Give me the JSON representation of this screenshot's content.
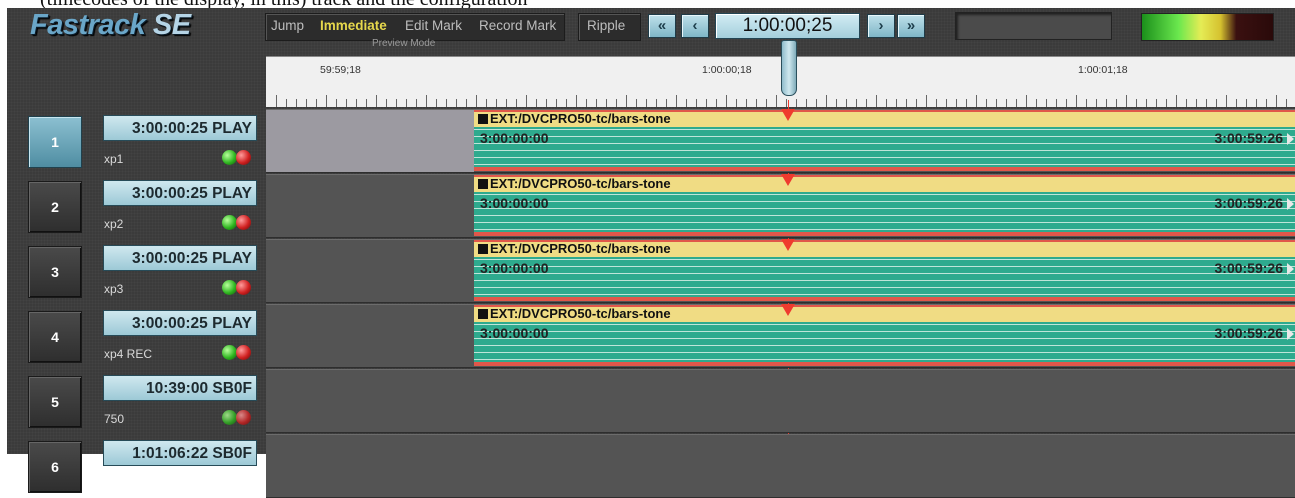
{
  "app": {
    "logo_main": "Fastrack",
    "logo_suffix": "SE"
  },
  "caption": {
    "text": "(timecodes of the display, in this) track and the configuration"
  },
  "toolbar": {
    "items": [
      "Jump",
      "Immediate",
      "Edit Mark",
      "Record Mark"
    ],
    "active": "Immediate",
    "ripple": "Ripple",
    "preview_mode_label": "Preview Mode"
  },
  "transport": {
    "rewind_all_icon": "double-left-arrow-icon",
    "step_back_icon": "left-arrow-icon",
    "timecode": "1:00:00;25",
    "step_forward_icon": "right-arrow-icon",
    "forward_all_icon": "double-right-arrow-icon"
  },
  "ruler": {
    "labels": [
      "59:59;18",
      "1:00:00;18",
      "1:00:01;18"
    ]
  },
  "tracks": [
    {
      "num": "1",
      "timecode": "3:00:00:25 PLAY",
      "name": "xp1",
      "selected": true,
      "clip": {
        "name": "EXT:/DVCPRO50-tc/bars-tone",
        "in": "3:00:00:00",
        "out": "3:00:59:26"
      }
    },
    {
      "num": "2",
      "timecode": "3:00:00:25 PLAY",
      "name": "xp2",
      "selected": false,
      "clip": {
        "name": "EXT:/DVCPRO50-tc/bars-tone",
        "in": "3:00:00:00",
        "out": "3:00:59:26"
      }
    },
    {
      "num": "3",
      "timecode": "3:00:00:25 PLAY",
      "name": "xp3",
      "selected": false,
      "clip": {
        "name": "EXT:/DVCPRO50-tc/bars-tone",
        "in": "3:00:00:00",
        "out": "3:00:59:26"
      }
    },
    {
      "num": "4",
      "timecode": "3:00:00:25 PLAY",
      "name": "xp4 REC",
      "selected": false,
      "clip": {
        "name": "EXT:/DVCPRO50-tc/bars-tone",
        "in": "3:00:00:00",
        "out": "3:00:59:26"
      }
    },
    {
      "num": "5",
      "timecode": "10:39:00 SB0F",
      "name": "750",
      "selected": false,
      "clip": null
    },
    {
      "num": "6",
      "timecode": "1:01:06:22 SB0F",
      "name": "",
      "selected": false,
      "clip": null
    }
  ],
  "colors": {
    "accent_teal": "#2eaa8e",
    "playhead_red": "#ef3b2e",
    "active_yellow": "#e6d84c"
  }
}
